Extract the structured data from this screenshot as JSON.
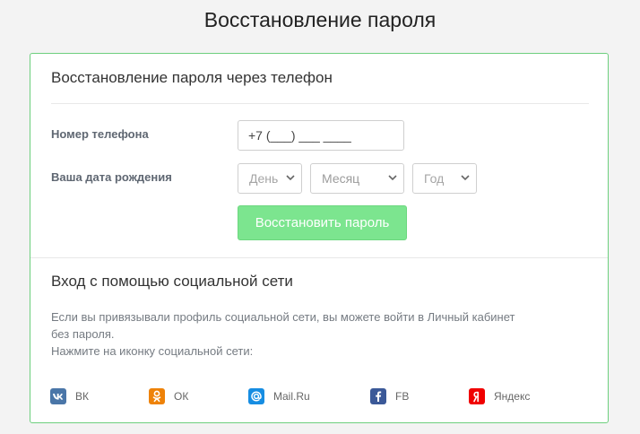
{
  "page": {
    "title": "Восстановление пароля"
  },
  "phone_section": {
    "title": "Восстановление пароля через телефон",
    "phone_label": "Номер телефона",
    "phone_value": "+7 (___) ___ ____",
    "birthdate_label": "Ваша дата рождения",
    "day_placeholder": "День",
    "month_placeholder": "Месяц",
    "year_placeholder": "Год",
    "submit_label": "Восстановить пароль"
  },
  "social_section": {
    "title": "Вход с помощью социальной сети",
    "description_line1": "Если вы привязывали профиль социальной сети, вы можете войти в Личный кабинет",
    "description_line2": "без пароля.",
    "description_line3": "Нажмите на иконку социальной сети:",
    "networks": [
      {
        "label": "ВК",
        "icon": "vk-icon",
        "color": "#4a76a8",
        "glyph": "vk"
      },
      {
        "label": "ОК",
        "icon": "odnoklassniki-icon",
        "color": "#ee8208",
        "glyph": "ok"
      },
      {
        "label": "Mail.Ru",
        "icon": "mailru-icon",
        "color": "#168de2",
        "glyph": "@"
      },
      {
        "label": "FB",
        "icon": "facebook-icon",
        "color": "#3b5998",
        "glyph": "f"
      },
      {
        "label": "Яндекс",
        "icon": "yandex-icon",
        "color": "#f00000",
        "glyph": "Я"
      }
    ]
  },
  "colors": {
    "accent_border": "#6dcf7e",
    "button_green": "#7ce58f"
  }
}
